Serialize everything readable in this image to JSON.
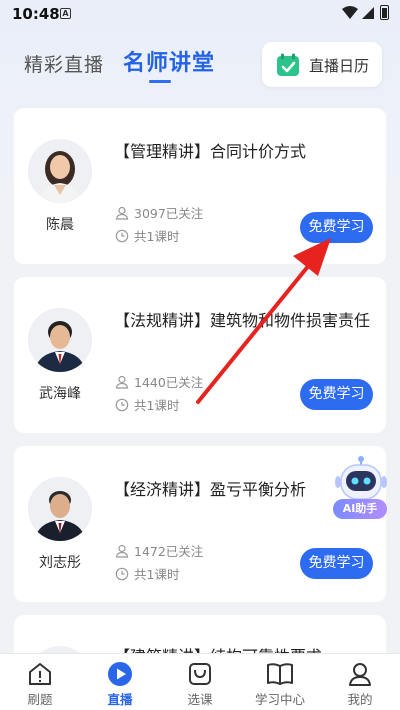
{
  "status_bar": {
    "time": "10:48",
    "notification_glyph": "A"
  },
  "tabs": {
    "live": "精彩直播",
    "master": "名师讲堂",
    "calendar_label": "直播日历"
  },
  "courses": [
    {
      "title": "【管理精讲】合同计价方式",
      "teacher": "陈晨",
      "followers": "3097已关注",
      "lessons": "共1课时",
      "button": "免费学习"
    },
    {
      "title": "【法规精讲】建筑物和物件损害责任",
      "teacher": "武海峰",
      "followers": "1440已关注",
      "lessons": "共1课时",
      "button": "免费学习"
    },
    {
      "title": "【经济精讲】盈亏平衡分析",
      "teacher": "刘志彤",
      "followers": "1472已关注",
      "lessons": "共1课时",
      "button": "免费学习"
    },
    {
      "title": "【建筑精讲】结构可靠性要求"
    }
  ],
  "ai_helper": {
    "label": "AI助手"
  },
  "bottom_nav": [
    {
      "label": "刷题",
      "icon": "home-alert-icon"
    },
    {
      "label": "直播",
      "icon": "play-icon"
    },
    {
      "label": "选课",
      "icon": "cart-icon"
    },
    {
      "label": "学习中心",
      "icon": "book-icon"
    },
    {
      "label": "我的",
      "icon": "user-icon"
    }
  ],
  "colors": {
    "accent": "#2d6bf0",
    "annotation_arrow": "#e6231e"
  }
}
